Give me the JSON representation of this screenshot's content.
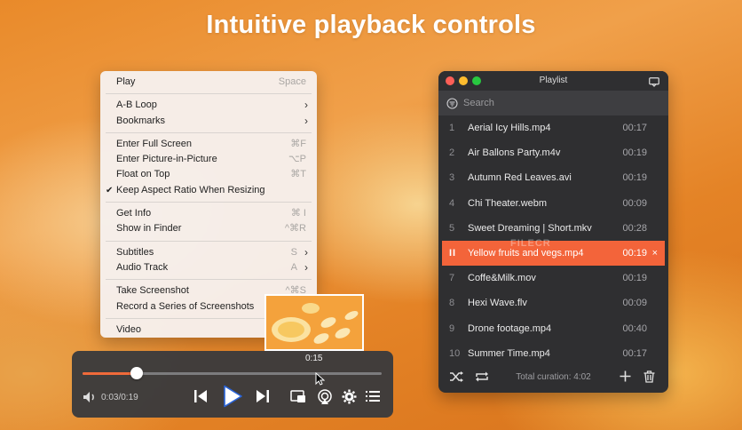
{
  "headline": "Intuitive playback controls",
  "menu": {
    "play": {
      "label": "Play",
      "shortcut": "Space"
    },
    "ab_loop": {
      "label": "A-B Loop"
    },
    "bookmarks": {
      "label": "Bookmarks"
    },
    "full_screen": {
      "label": "Enter Full Screen",
      "shortcut": "⌘F"
    },
    "pip": {
      "label": "Enter Picture-in-Picture",
      "shortcut": "⌥P"
    },
    "float_top": {
      "label": "Float on Top",
      "shortcut": "⌘T"
    },
    "keep_aspect": {
      "label": "Keep Aspect Ratio When Resizing",
      "checked": true
    },
    "get_info": {
      "label": "Get Info",
      "shortcut": "⌘ I"
    },
    "show_finder": {
      "label": "Show in Finder",
      "shortcut": "^⌘R"
    },
    "subtitles": {
      "label": "Subtitles",
      "shortcut": "S"
    },
    "audio_track": {
      "label": "Audio Track",
      "shortcut": "A"
    },
    "take_screenshot": {
      "label": "Take Screenshot",
      "shortcut": "^⌘S"
    },
    "series_screenshots": {
      "label": "Record a Series of Screenshots"
    },
    "video": {
      "label": "Video"
    }
  },
  "player": {
    "hover_time": "0:15",
    "time": "0:03/0:19",
    "progress": 0.18
  },
  "playlist": {
    "title": "Playlist",
    "search_placeholder": "Search",
    "items": [
      {
        "num": "1",
        "name": "Aerial Icy Hills.mp4",
        "dur": "00:17"
      },
      {
        "num": "2",
        "name": "Air Ballons Party.m4v",
        "dur": "00:19"
      },
      {
        "num": "3",
        "name": "Autumn Red Leaves.avi",
        "dur": "00:19"
      },
      {
        "num": "4",
        "name": "Chi Theater.webm",
        "dur": "00:09"
      },
      {
        "num": "5",
        "name": "Sweet Dreaming | Short.mkv",
        "dur": "00:28"
      },
      {
        "num": "II",
        "name": "Yellow fruits and vegs.mp4",
        "dur": "00:19",
        "active": true,
        "remove": "×"
      },
      {
        "num": "7",
        "name": "Coffe&Milk.mov",
        "dur": "00:19"
      },
      {
        "num": "8",
        "name": "Hexi Wave.flv",
        "dur": "00:09"
      },
      {
        "num": "9",
        "name": "Drone footage.mp4",
        "dur": "00:40"
      },
      {
        "num": "10",
        "name": "Summer Time.mp4",
        "dur": "00:17"
      }
    ],
    "total": "Total curation: 4:02"
  },
  "watermark": "FILECR",
  "colors": {
    "accent": "#f3643a",
    "panel": "#2f2f31",
    "menu_bg": "#f6f0ec"
  },
  "icons": [
    "volume-icon",
    "previous-icon",
    "play-icon",
    "next-icon",
    "pip-icon",
    "airplay-icon",
    "settings-icon",
    "playlist-icon",
    "shuffle-icon",
    "repeat-icon",
    "add-icon",
    "trash-icon",
    "search-icon",
    "chat-icon"
  ]
}
